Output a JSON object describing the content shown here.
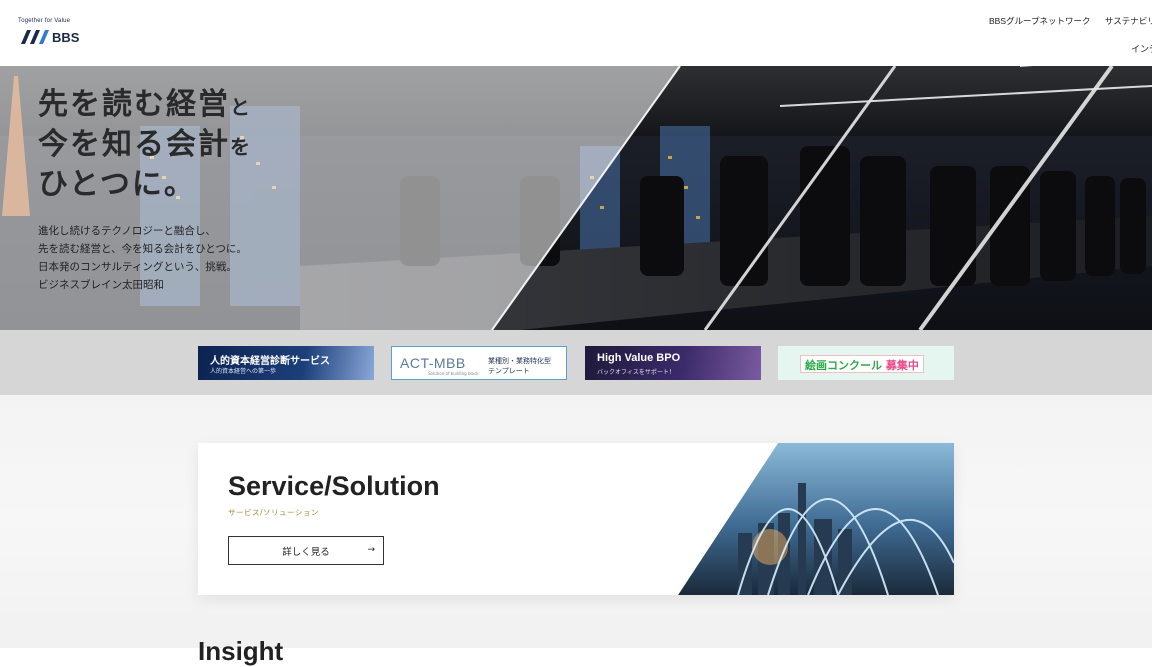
{
  "header": {
    "logo": {
      "tagline": "Together for Value",
      "name": "BBS"
    },
    "nav": [
      "BBSグループネットワーク",
      "サステナビリティ"
    ],
    "nav_second": "インデックス"
  },
  "hero": {
    "headline": [
      {
        "big": "先を読む経営",
        "small": "と"
      },
      {
        "big": "今を知る会計",
        "small": "を"
      },
      {
        "big": "ひとつに。",
        "small": ""
      }
    ],
    "body": [
      "進化し続けるテクノロジーと融合し、",
      "先を読む経営と、今を知る会計をひとつに。",
      "日本発のコンサルティングという、挑戦。",
      "ビジネスブレイン太田昭和"
    ]
  },
  "banners": {
    "hcm": {
      "title": "人的資本経営診断サービス",
      "subtitle": "人的資本経営への第一歩"
    },
    "actmbb": {
      "logo": "ACT-MBB",
      "logo_sub": "Solution of building block",
      "line1": "業種別・業務特化型",
      "line2": "テンプレート"
    },
    "bpo": {
      "title": "High Value BPO",
      "subtitle": "バックオフィスをサポート！"
    },
    "contest": {
      "text_green": "絵画コンクール",
      "text_pink": "募集中"
    }
  },
  "service": {
    "title": "Service/Solution",
    "subtitle": "サービス/ソリューション",
    "button": "詳しく見る",
    "button_arrow": "→"
  },
  "next_section": {
    "heading": "Insight"
  },
  "colors": {
    "brand_navy": "#1a2a4a",
    "accent_gold": "#a78a3a",
    "banner_strip": "#d6d6d6"
  }
}
